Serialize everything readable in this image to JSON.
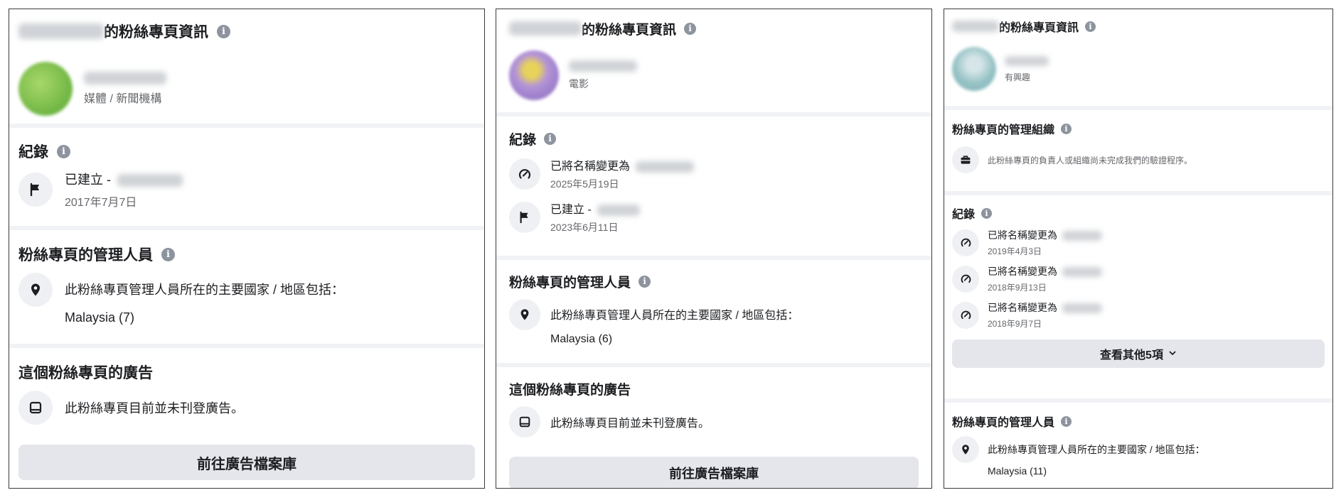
{
  "panels": [
    {
      "header_title": "的粉絲專頁資訊",
      "page_category": "媒體 / 新聞機構",
      "record_title": "紀錄",
      "records": [
        {
          "label": "已建立 -",
          "date": "2017年7月7日"
        }
      ],
      "admin_title": "粉絲專頁的管理人員",
      "admin_text": "此粉絲專頁管理人員所在的主要國家 / 地區包括：",
      "admin_country": "Malaysia (7)",
      "ads_title": "這個粉絲專頁的廣告",
      "ads_text": "此粉絲專頁目前並未刊登廣告。",
      "ads_button": "前往廣告檔案庫"
    },
    {
      "header_title": "的粉絲專頁資訊",
      "page_category": "電影",
      "record_title": "紀錄",
      "records": [
        {
          "label": "已將名稱變更為",
          "date": "2025年5月19日"
        },
        {
          "label": "已建立 -",
          "date": "2023年6月11日"
        }
      ],
      "admin_title": "粉絲專頁的管理人員",
      "admin_text": "此粉絲專頁管理人員所在的主要國家 / 地區包括：",
      "admin_country": "Malaysia (6)",
      "ads_title": "這個粉絲專頁的廣告",
      "ads_text": "此粉絲專頁目前並未刊登廣告。",
      "ads_button": "前往廣告檔案庫"
    },
    {
      "header_title": "的粉絲專頁資訊",
      "page_category": "有興趣",
      "org_title": "粉絲專頁的管理組織",
      "org_text": "此粉絲專頁的負責人或組織尚未完成我們的驗證程序。",
      "record_title": "紀錄",
      "records": [
        {
          "label": "已將名稱變更為",
          "date": "2019年4月3日"
        },
        {
          "label": "已將名稱變更為",
          "date": "2018年9月13日"
        },
        {
          "label": "已將名稱變更為",
          "date": "2018年9月7日"
        }
      ],
      "more_button": "查看其他5項",
      "admin_title": "粉絲專頁的管理人員",
      "admin_text": "此粉絲專頁管理人員所在的主要國家 / 地區包括：",
      "admin_country": "Malaysia (11)"
    }
  ],
  "info_glyph": "i",
  "icons": {
    "info": "info-icon",
    "flag": "flag-icon",
    "rename": "rename-icon",
    "location": "location-pin-icon",
    "ads": "ads-icon",
    "briefcase": "briefcase-icon",
    "chevron": "chevron-down-icon"
  },
  "colors": {
    "panel_bg": "#f0f2f5",
    "button_bg": "#e4e6eb",
    "icon_bg": "#eef0f3",
    "secondary_text": "#65676b",
    "info_icon": "#8d949e"
  }
}
